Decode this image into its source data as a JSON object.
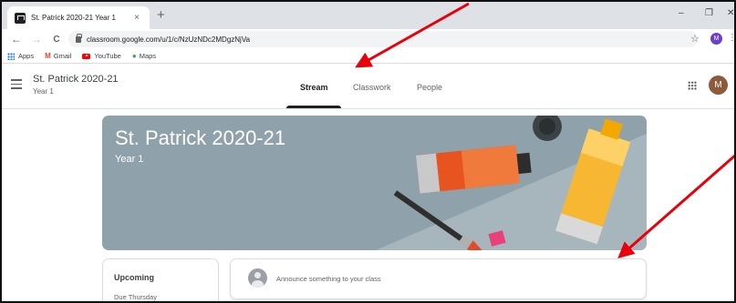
{
  "browser": {
    "tab_title": "St. Patrick 2020-21 Year 1",
    "tab_close": "×",
    "new_tab": "+",
    "window_controls": {
      "minimize": "–",
      "restore": "❐",
      "close": "✕"
    },
    "nav": {
      "back": "←",
      "forward": "→",
      "reload": "C"
    },
    "url": "classroom.google.com/u/1/c/NzUzNDc2MDgzNjVa",
    "star": "☆",
    "profile_initial": "M",
    "menu": "⋮"
  },
  "bookmarks": [
    {
      "label": "Apps",
      "icon": "apps-grid-icon"
    },
    {
      "label": "Gmail",
      "icon": "gmail-icon"
    },
    {
      "label": "YouTube",
      "icon": "youtube-icon"
    },
    {
      "label": "Maps",
      "icon": "maps-icon"
    }
  ],
  "header": {
    "class_name": "St. Patrick 2020-21",
    "section": "Year 1",
    "tabs": [
      {
        "label": "Stream",
        "active": true
      },
      {
        "label": "Classwork",
        "active": false
      },
      {
        "label": "People",
        "active": false
      }
    ],
    "avatar_initial": "M"
  },
  "banner": {
    "title": "St. Patrick 2020-21",
    "subtitle": "Year 1"
  },
  "upcoming": {
    "title": "Upcoming",
    "due": "Due Thursday"
  },
  "announce": {
    "placeholder": "Announce something to your class"
  },
  "colors": {
    "banner_bg": "#8fa2ab",
    "annotation_arrow": "#e8000b",
    "active_tab_underline": "#202124"
  }
}
